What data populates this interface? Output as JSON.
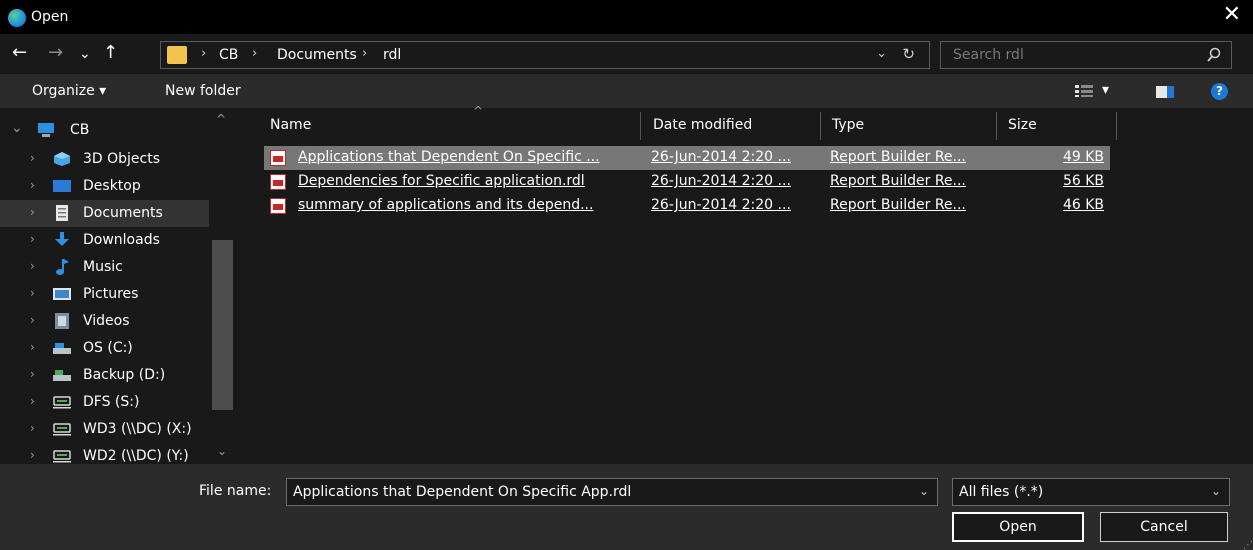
{
  "window": {
    "title": "Open",
    "close_glyph": "✕",
    "app_icon": "edge-icon"
  },
  "nav": {
    "back": "←",
    "forward": "→",
    "recent": "⌄",
    "up": "↑",
    "breadcrumbs": [
      "CB",
      "Documents",
      "rdl"
    ],
    "separator": "›",
    "dropdown": "⌄",
    "refresh": "↻",
    "search_placeholder": "Search rdl"
  },
  "toolbar": {
    "organize": "Organize ▾",
    "new_folder": "New folder",
    "view_drop": "▾",
    "help": "?"
  },
  "sidebar": {
    "items": [
      {
        "label": "CB",
        "icon": "computer-icon",
        "chevron": "⌄"
      },
      {
        "label": "3D Objects",
        "icon": "3d-objects-icon",
        "chevron": "›"
      },
      {
        "label": "Desktop",
        "icon": "desktop-icon",
        "chevron": "›"
      },
      {
        "label": "Documents",
        "icon": "documents-icon",
        "chevron": "›",
        "selected": true
      },
      {
        "label": "Downloads",
        "icon": "downloads-icon",
        "chevron": "›"
      },
      {
        "label": "Music",
        "icon": "music-icon",
        "chevron": "›"
      },
      {
        "label": "Pictures",
        "icon": "pictures-icon",
        "chevron": "›"
      },
      {
        "label": "Videos",
        "icon": "videos-icon",
        "chevron": "›"
      },
      {
        "label": "OS (C:)",
        "icon": "drive-icon",
        "chevron": "›"
      },
      {
        "label": "Backup (D:)",
        "icon": "drive-icon",
        "chevron": "›"
      },
      {
        "label": "DFS (S:)",
        "icon": "network-drive-icon",
        "chevron": "›"
      },
      {
        "label": "WD3 (\\\\DC) (X:)",
        "icon": "network-drive-icon",
        "chevron": "›"
      },
      {
        "label": "WD2 (\\\\DC) (Y:)",
        "icon": "network-drive-icon",
        "chevron": "›"
      }
    ],
    "scroll_up": "^",
    "scroll_down": "⌄"
  },
  "columns": {
    "name": "Name",
    "date": "Date modified",
    "type": "Type",
    "size": "Size",
    "sort_indicator": "^"
  },
  "files": [
    {
      "name": "Applications that Dependent On Specific ...",
      "date": "26-Jun-2014 2:20 ...",
      "type": "Report Builder Re...",
      "size": "49 KB",
      "selected": true
    },
    {
      "name": "Dependencies for Specific application.rdl",
      "date": "26-Jun-2014 2:20 ...",
      "type": "Report Builder Re...",
      "size": "56 KB"
    },
    {
      "name": "summary of applications and its depend...",
      "date": "26-Jun-2014 2:20 ...",
      "type": "Report Builder Re...",
      "size": "46 KB"
    }
  ],
  "footer": {
    "file_name_label": "File name:",
    "file_name_value": "Applications that Dependent On Specific App.rdl",
    "file_type_value": "All files (*.*)",
    "dropdown": "⌄",
    "open": "Open",
    "cancel": "Cancel"
  }
}
